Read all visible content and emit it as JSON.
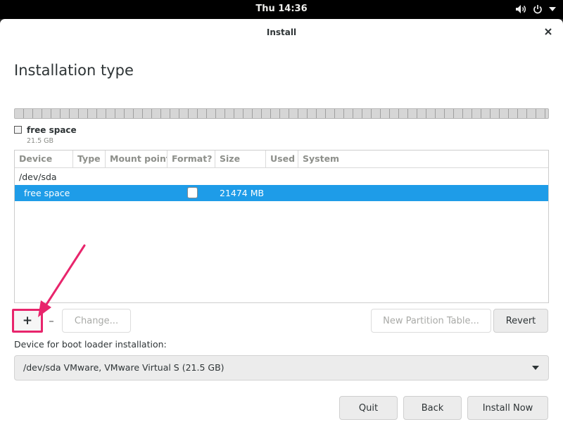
{
  "topbar": {
    "clock": "Thu 14:36",
    "icons": [
      "volume-icon",
      "power-icon",
      "chevron-down-icon"
    ]
  },
  "window": {
    "title": "Install",
    "close_glyph": "×"
  },
  "page": {
    "heading": "Installation type"
  },
  "partition_bar": {
    "legend_name": "free space",
    "legend_size": "21.5 GB"
  },
  "table": {
    "columns": [
      "Device",
      "Type",
      "Mount point",
      "Format?",
      "Size",
      "Used",
      "System"
    ],
    "device": "/dev/sda",
    "selected_row": {
      "device": "free space",
      "type": "",
      "mount": "",
      "format_checked": false,
      "size": "21474 MB",
      "used": "",
      "system": ""
    }
  },
  "partition_buttons": {
    "add": "+",
    "remove": "–",
    "change": "Change...",
    "new_table": "New Partition Table...",
    "revert": "Revert"
  },
  "bootloader": {
    "label": "Device for boot loader installation:",
    "value": "/dev/sda VMware, VMware Virtual S (21.5 GB)"
  },
  "footer": {
    "quit": "Quit",
    "back": "Back",
    "install": "Install Now"
  },
  "colors": {
    "selection": "#1e9ce8",
    "annotation": "#e8256c"
  }
}
